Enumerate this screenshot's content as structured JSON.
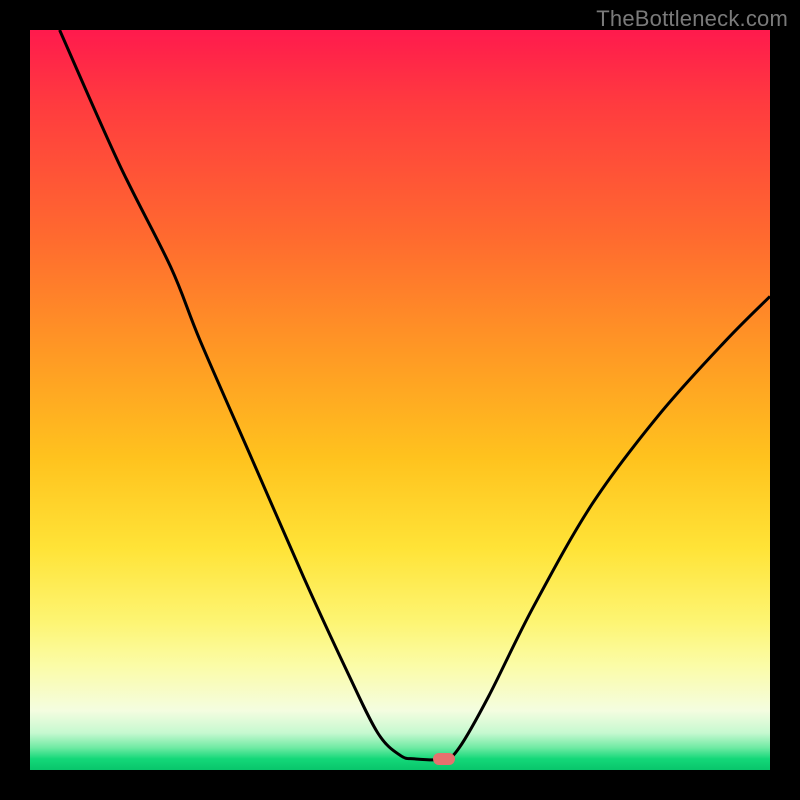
{
  "watermark": "TheBottleneck.com",
  "chart_data": {
    "type": "line",
    "title": "",
    "xlabel": "",
    "ylabel": "",
    "xlim": [
      0,
      100
    ],
    "ylim": [
      0,
      100
    ],
    "grid": false,
    "legend": false,
    "curve_points": [
      {
        "x": 4,
        "y": 100
      },
      {
        "x": 12,
        "y": 82
      },
      {
        "x": 19,
        "y": 68
      },
      {
        "x": 23,
        "y": 58
      },
      {
        "x": 30,
        "y": 42
      },
      {
        "x": 37,
        "y": 26
      },
      {
        "x": 43,
        "y": 13
      },
      {
        "x": 47,
        "y": 5
      },
      {
        "x": 50,
        "y": 2
      },
      {
        "x": 52,
        "y": 1.5
      },
      {
        "x": 56,
        "y": 1.5
      },
      {
        "x": 58,
        "y": 3
      },
      {
        "x": 62,
        "y": 10
      },
      {
        "x": 68,
        "y": 22
      },
      {
        "x": 76,
        "y": 36
      },
      {
        "x": 85,
        "y": 48
      },
      {
        "x": 94,
        "y": 58
      },
      {
        "x": 100,
        "y": 64
      }
    ],
    "marker": {
      "x": 56,
      "y": 1.5,
      "color": "#e6716e"
    },
    "line_color": "#000000",
    "line_width": 3
  },
  "layout": {
    "outer_size": 800,
    "plot_inset": 30,
    "plot_size": 740
  }
}
